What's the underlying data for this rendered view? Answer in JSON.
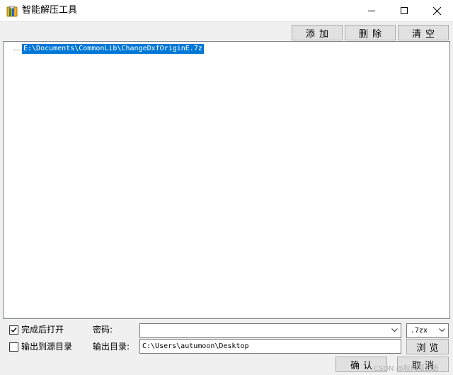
{
  "window": {
    "title": "智能解压工具"
  },
  "toolbar": {
    "add_label": "添加",
    "delete_label": "删除",
    "clear_label": "清空"
  },
  "tree": {
    "items": [
      {
        "label": "E:\\Documents\\CommonLib\\ChangeDxfOriginE.7z",
        "selected": true
      }
    ]
  },
  "options": {
    "open_after_complete": {
      "label": "完成后打开",
      "checked": true
    },
    "output_to_source": {
      "label": "输出到源目录",
      "checked": false
    }
  },
  "password": {
    "label": "密码:",
    "value": ""
  },
  "extension": {
    "selected": ".7zx"
  },
  "output": {
    "label": "输出目录:",
    "value": "C:\\Users\\autumoon\\Desktop",
    "browse_label": "浏览"
  },
  "actions": {
    "confirm_label": "确认",
    "cancel_label": "取消"
  },
  "watermark": "CSDN @秋风孤云语",
  "colors": {
    "selection": "#0078d7",
    "background": "#f0f0f0",
    "button": "#e1e1e1"
  }
}
